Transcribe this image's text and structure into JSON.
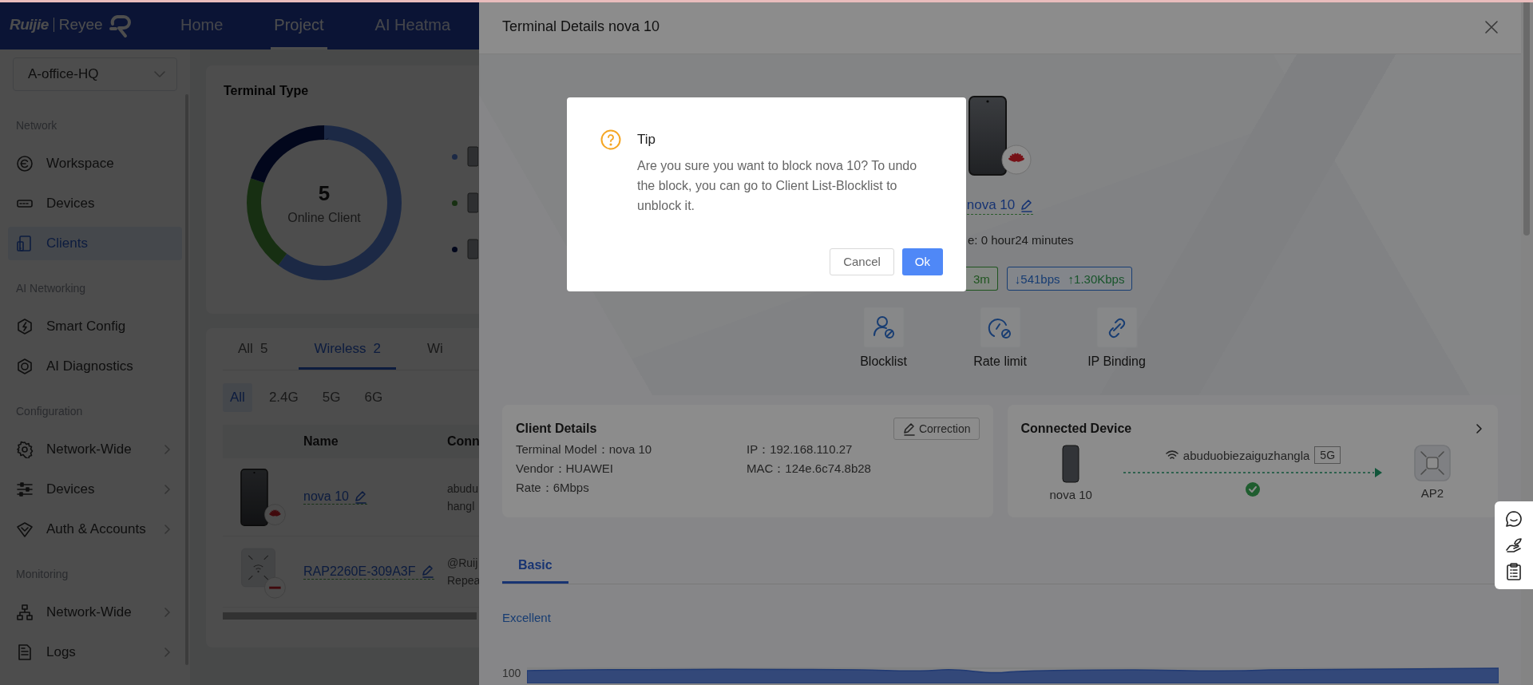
{
  "top_bar": {
    "logo": {
      "brand": "Ruijie",
      "product": "Reyee"
    },
    "nav_tabs": [
      {
        "label": "Home",
        "selected": false
      },
      {
        "label": "Project",
        "selected": true
      },
      {
        "label": "AI Heatma",
        "selected": false
      }
    ]
  },
  "sidebar": {
    "site_select": "A-office-HQ",
    "sections": [
      {
        "title": "Network",
        "items": [
          {
            "label": "Workspace",
            "selected": false,
            "expandable": false
          },
          {
            "label": "Devices",
            "selected": false,
            "expandable": false
          },
          {
            "label": "Clients",
            "selected": true,
            "expandable": false
          }
        ]
      },
      {
        "title": "AI Networking",
        "items": [
          {
            "label": "Smart Config",
            "selected": false,
            "expandable": false
          },
          {
            "label": "AI Diagnostics",
            "selected": false,
            "expandable": false
          }
        ]
      },
      {
        "title": "Configuration",
        "items": [
          {
            "label": "Network-Wide",
            "selected": false,
            "expandable": true
          },
          {
            "label": "Devices",
            "selected": false,
            "expandable": true
          },
          {
            "label": "Auth & Accounts",
            "selected": false,
            "expandable": true
          }
        ]
      },
      {
        "title": "Monitoring",
        "items": [
          {
            "label": "Network-Wide",
            "selected": false,
            "expandable": true
          },
          {
            "label": "Logs",
            "selected": false,
            "expandable": true
          }
        ]
      }
    ]
  },
  "terminal_type": {
    "title": "Terminal Type",
    "count": "5",
    "caption": "Online Client",
    "legend": [
      {
        "color": "#1c2a46"
      },
      {
        "color": "#183012"
      },
      {
        "color": "#03081c"
      }
    ]
  },
  "client_tabs": [
    {
      "label": "All",
      "count": "5",
      "selected": false
    },
    {
      "label": "Wireless",
      "count": "2",
      "selected": true
    },
    {
      "label": "Wi",
      "selected": false
    }
  ],
  "band_filters": [
    {
      "label": "All",
      "selected": true
    },
    {
      "label": "2.4G",
      "selected": false
    },
    {
      "label": "5G",
      "selected": false
    },
    {
      "label": "6G",
      "selected": false
    }
  ],
  "client_table": {
    "columns": [
      "Name",
      "Conn"
    ],
    "rows": [
      {
        "kind": "phone",
        "name": "nova 10",
        "connection": [
          "abudu",
          "hangl"
        ]
      },
      {
        "kind": "access-point",
        "name": "RAP2260E-309A3F",
        "connection": [
          "@Ruij",
          "Repea"
        ]
      }
    ]
  },
  "drawer": {
    "title": "Terminal Details nova 10",
    "device_name": "nova 10",
    "online_time": "e: 0 hour24 minutes",
    "signal_tag": "3m",
    "rate_tag": {
      "down": "↓541bps",
      "up": "↑1.30Kbps"
    },
    "actions": [
      {
        "label": "Blocklist"
      },
      {
        "label": "Rate limit"
      },
      {
        "label": "IP Binding"
      }
    ],
    "client_details": {
      "title": "Client Details",
      "correction_button": "Correction",
      "fields": [
        "Terminal Model：nova 10",
        "IP：192.168.110.27",
        "Vendor：HUAWEI",
        "MAC：124e.6c74.8b28",
        "Rate：6Mbps"
      ]
    },
    "connected_device": {
      "title": "Connected Device",
      "client_name": "nova 10",
      "ssid": "abuduobiezaiguzhangla",
      "band": "5G",
      "device_name": "AP2",
      "connected": true
    },
    "tabs": [
      {
        "label": "Basic",
        "selected": true
      }
    ],
    "signal_chart": {
      "quality": "Excellent",
      "y_tick_labels": [
        "100"
      ]
    }
  },
  "dialog": {
    "title": "Tip",
    "message": "Are you sure you want to block nova 10? To undo the block, you can go to Client List-Blocklist to unblock it.",
    "buttons": [
      {
        "label": "Cancel",
        "kind": "default"
      },
      {
        "label": "Ok",
        "kind": "primary"
      }
    ]
  }
}
